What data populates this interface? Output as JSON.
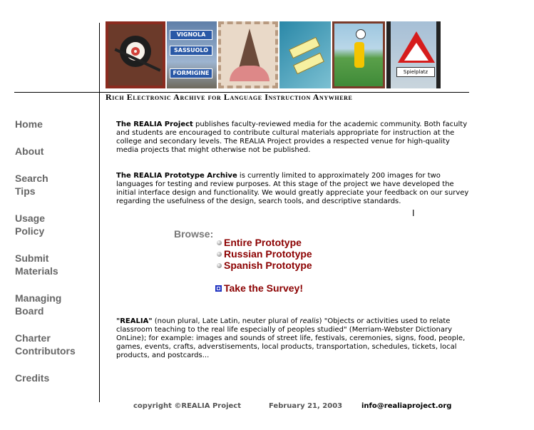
{
  "banner": {
    "sign_labels": [
      "VIGNOLA",
      "SASSUOLO",
      "FORMIGINE"
    ],
    "playground_sign": "Spielplatz"
  },
  "tagline": "Rich Electronic Archive for Language Instruction Anywhere",
  "nav": [
    {
      "label": "Home"
    },
    {
      "label": "About"
    },
    {
      "label": "Search Tips"
    },
    {
      "label": "Usage Policy"
    },
    {
      "label": "Submit Materials"
    },
    {
      "label": "Managing Board"
    },
    {
      "label": "Charter Contributors"
    },
    {
      "label": "Credits"
    }
  ],
  "intro": {
    "p1_bold": "The REALIA Project",
    "p1_rest": " publishes faculty-reviewed media for the academic community. Both faculty and students are encouraged to contribute cultural materials appropriate for instruction at the college and secondary levels. The REALIA Project provides a respected venue for high-quality media projects that might otherwise not be published.",
    "p2_bold": "The REALIA Prototype Archive",
    "p2_rest": " is currently limited to approximately 200 images for two languages for testing and review purposes. At this stage of the project we have developed the initial interface design and functionality. We would greatly appreciate your feedback on our survey regarding the usefulness of the design, search tools, and descriptive standards."
  },
  "browse": {
    "label": "Browse:",
    "items": [
      "Entire Prototype",
      "Russian Prototype",
      "Spanish Prototype"
    ]
  },
  "survey": {
    "label": "Take the Survey!"
  },
  "definition": {
    "term": "\"REALIA\"",
    "text_a": " (noun plural, Late Latin, neuter plural of ",
    "text_italic": "realis",
    "text_b": ") \"Objects or activities used to relate classroom teaching to the real life especially of peoples studied\" (Merriam-Webster Dictionary OnLine); for example: images and sounds of street life, festivals, ceremonies, signs, food, people, games, events, crafts, adverstisements, local products, transportation, schedules, tickets, local products, and postcards..."
  },
  "footer": {
    "copyright": "copyright ©REALIA Project",
    "date": "February 21, 2003",
    "email": "info@realiaproject.org"
  },
  "colors": {
    "nav_text": "#666666",
    "link_text": "#8b0000",
    "browse_label": "#777777",
    "checkbox": "#1c2fbf"
  }
}
